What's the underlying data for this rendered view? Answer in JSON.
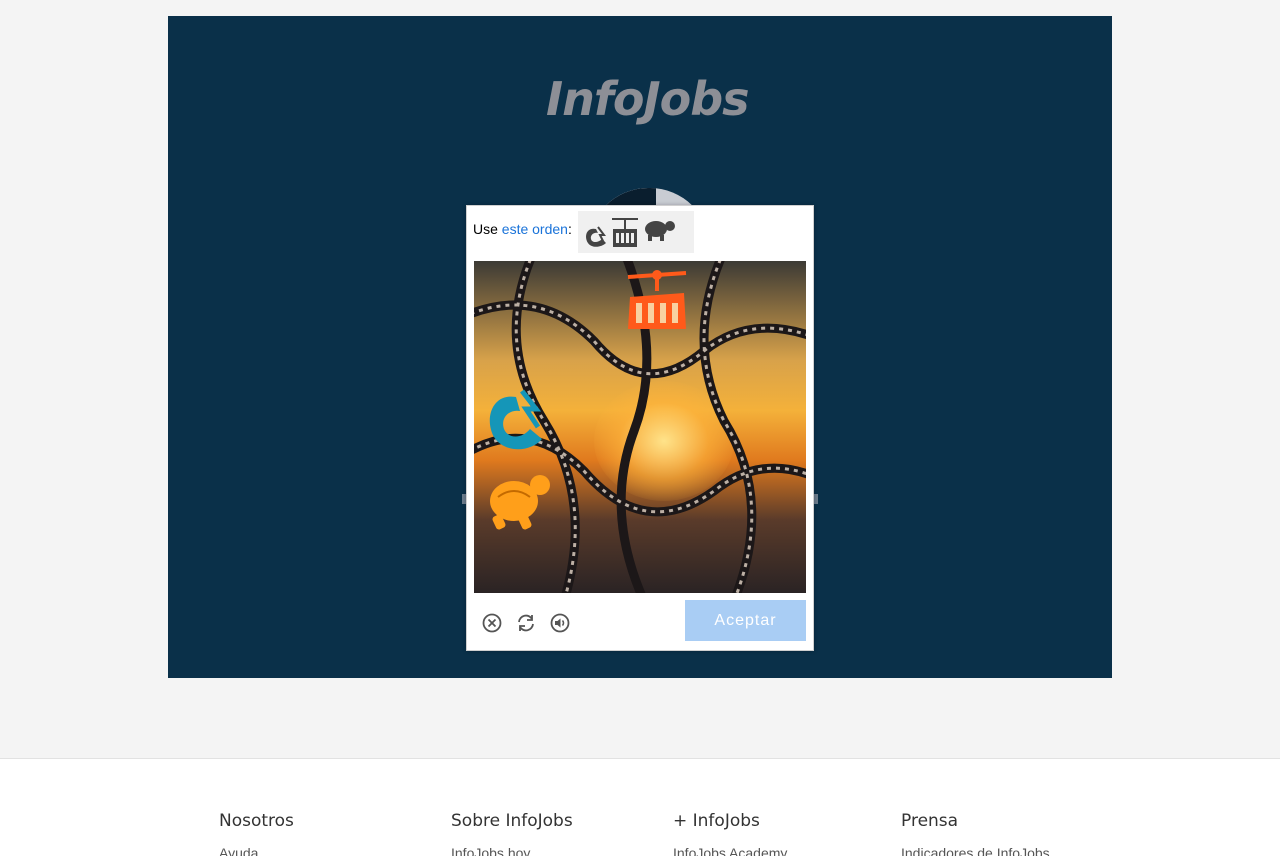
{
  "brand": {
    "logo_text": "InfoJobs"
  },
  "captcha": {
    "instruction_prefix": "Use",
    "instruction_link": "este orden",
    "instruction_suffix": ":",
    "order": [
      "magnet-icon",
      "cable-car-icon",
      "turtle-icon"
    ],
    "challenge_objects": [
      "cable-car-icon",
      "magnet-icon",
      "turtle-icon"
    ],
    "controls": [
      "close-icon",
      "refresh-icon",
      "audio-icon"
    ],
    "accept_label": "Aceptar",
    "colors": {
      "accept_bg": "#a9cdf4",
      "link": "#1a73d9",
      "cable_car": "#ff5a1a",
      "magnet": "#1596b8",
      "turtle": "#ff9f1a"
    }
  },
  "footer": {
    "columns": [
      {
        "heading": "Nosotros",
        "first_link": "Ayuda"
      },
      {
        "heading": "Sobre InfoJobs",
        "first_link": "InfoJobs hoy"
      },
      {
        "heading": "+ InfoJobs",
        "first_link": "InfoJobs Academy"
      },
      {
        "heading": "Prensa",
        "first_link": "Indicadores de InfoJobs"
      }
    ]
  },
  "colors": {
    "hero_bg": "#0a3049",
    "page_bg": "#f4f4f4"
  }
}
